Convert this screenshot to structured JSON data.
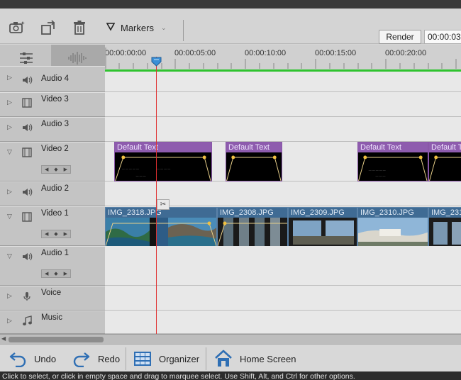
{
  "toolbar": {
    "markers_label": "Markers",
    "render_label": "Render",
    "timecode": "00:00:03"
  },
  "ruler": {
    "ticks": [
      "00:00:00:00",
      "00:00:05:00",
      "00:00:10:00",
      "00:00:15:00",
      "00:00:20:00"
    ]
  },
  "tracks": [
    {
      "name": "Audio 4",
      "kind": "audio",
      "expanded": false
    },
    {
      "name": "Video 3",
      "kind": "video",
      "expanded": false
    },
    {
      "name": "Audio 3",
      "kind": "audio",
      "expanded": false
    },
    {
      "name": "Video 2",
      "kind": "video",
      "expanded": true
    },
    {
      "name": "Audio 2",
      "kind": "audio",
      "expanded": false
    },
    {
      "name": "Video 1",
      "kind": "video",
      "expanded": true
    },
    {
      "name": "Audio 1",
      "kind": "audio",
      "expanded": true
    },
    {
      "name": "Voice",
      "kind": "voice",
      "expanded": false
    },
    {
      "name": "Music",
      "kind": "music",
      "expanded": false
    }
  ],
  "text_clips": [
    "Default Text",
    "Default Text",
    "Default Text",
    "Default Text"
  ],
  "image_clips": [
    "IMG_2318.JPG",
    "IMG_2308.JPG",
    "IMG_2309.JPG",
    "IMG_2310.JPG",
    "IMG_231"
  ],
  "bottombar": {
    "undo": "Undo",
    "redo": "Redo",
    "organizer": "Organizer",
    "home": "Home Screen"
  },
  "status": "Click to select, or click in empty space and drag to marquee select. Use Shift, Alt, and Ctrl for other options.",
  "colors": {
    "text_clip": "#8e5cae",
    "image_clip": "#3f6b94",
    "playhead": "#e03030",
    "render_bar": "#2fc32f"
  }
}
